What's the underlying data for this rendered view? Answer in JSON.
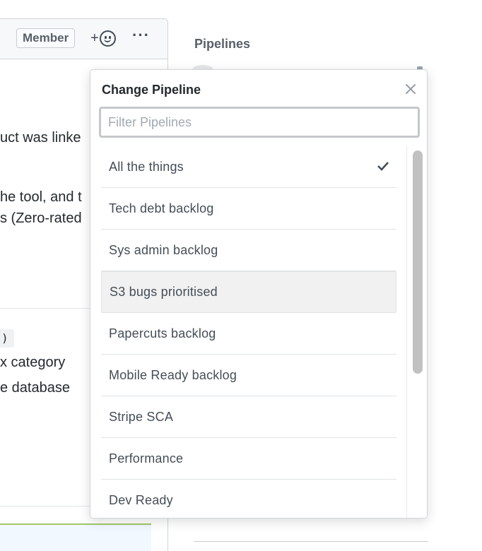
{
  "comment": {
    "member_badge": "Member",
    "lines": [
      "uct was linke",
      "he tool, and t",
      "s (Zero-rated",
      "x category",
      "e database"
    ],
    "code_chip": ")"
  },
  "sidebar": {
    "heading": "Pipelines"
  },
  "popover": {
    "title": "Change Pipeline",
    "filter_placeholder": "Filter Pipelines",
    "filter_value": "",
    "selected_index": 0,
    "highlighted_index": 3,
    "items": [
      {
        "label": "All the things",
        "selected": true
      },
      {
        "label": "Tech debt backlog",
        "selected": false
      },
      {
        "label": "Sys admin backlog",
        "selected": false
      },
      {
        "label": "S3 bugs prioritised",
        "selected": false
      },
      {
        "label": "Papercuts backlog",
        "selected": false
      },
      {
        "label": "Mobile Ready backlog",
        "selected": false
      },
      {
        "label": "Stripe SCA",
        "selected": false
      },
      {
        "label": "Performance",
        "selected": false
      },
      {
        "label": "Dev Ready",
        "selected": false
      }
    ]
  },
  "colors": {
    "accent_green": "#a2c76b",
    "highlight_bg": "#f1f1f1",
    "text_muted": "#586069"
  }
}
